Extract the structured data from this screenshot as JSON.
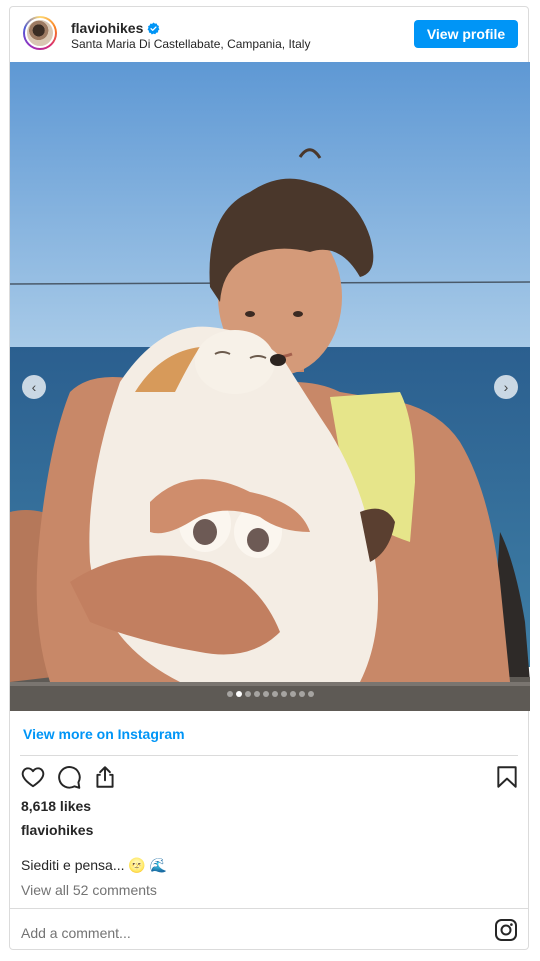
{
  "post": {
    "username": "flaviohikes",
    "location": "Santa Maria Di Castellabate, Campania, Italy",
    "view_profile_label": "View profile",
    "view_more_label": "View more on Instagram",
    "likes": "8,618 likes",
    "caption_user": "flaviohikes",
    "caption_text": "Siediti e pensa... 🌝 🌊",
    "comments_link": "View all 52 comments",
    "comment_placeholder": "Add a comment...",
    "carousel": {
      "slide_count": 10,
      "active_index": 1,
      "prev_glyph": "‹",
      "next_glyph": "›"
    }
  },
  "icons": {
    "verified": "verified-badge-icon",
    "like": "heart-icon",
    "comment": "comment-icon",
    "share": "share-icon",
    "save": "bookmark-icon",
    "brand": "instagram-icon"
  },
  "colors": {
    "accent": "#0095f6",
    "text": "#262626",
    "muted": "#737373",
    "border": "#dbdbdb"
  }
}
